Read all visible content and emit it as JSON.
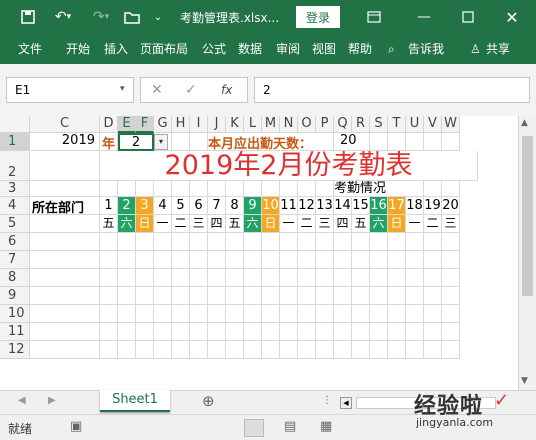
{
  "title": {
    "filename": "考勤管理表.xlsx...",
    "login": "登录"
  },
  "menu": [
    "文件",
    "开始",
    "插入",
    "页面布局",
    "公式",
    "数据",
    "审阅",
    "视图",
    "帮助",
    "告诉我",
    "共享"
  ],
  "formula": {
    "namebox": "E1",
    "value": "2",
    "fx": "fx"
  },
  "columns": [
    "C",
    "D",
    "E",
    "F",
    "G",
    "H",
    "I",
    "J",
    "K",
    "L",
    "M",
    "N",
    "O",
    "P",
    "Q",
    "R",
    "S",
    "T",
    "U",
    "V",
    "W"
  ],
  "rows": [
    "1",
    "2",
    "3",
    "4",
    "5",
    "6",
    "7",
    "8",
    "9",
    "10",
    "11",
    "12"
  ],
  "sheet": {
    "year": "2019",
    "year_label": "年",
    "month": "2",
    "days_label": "本月应出勤天数：",
    "days": "20",
    "title": "2019年2月份考勤表",
    "section": "考勤情况",
    "dept": "所在部门",
    "dates": [
      "1",
      "2",
      "3",
      "4",
      "5",
      "6",
      "7",
      "8",
      "9",
      "10",
      "11",
      "12",
      "13",
      "14",
      "15",
      "16",
      "17",
      "18",
      "19",
      "20"
    ],
    "weekdays": [
      "五",
      "六",
      "日",
      "一",
      "二",
      "三",
      "四",
      "五",
      "六",
      "日",
      "一",
      "二",
      "三",
      "四",
      "五",
      "六",
      "日",
      "一",
      "二",
      "三"
    ],
    "colors": {
      "weekend_green": "#21a366",
      "weekend_orange": "#f5a623",
      "title_red": "#e03131",
      "label_orange": "#c55a11"
    }
  },
  "tabs": {
    "sheet1": "Sheet1",
    "add": "⊕"
  },
  "status": {
    "ready": "就绪"
  },
  "watermark": {
    "line1": "经验啦",
    "line2": "jingyanla.com"
  }
}
